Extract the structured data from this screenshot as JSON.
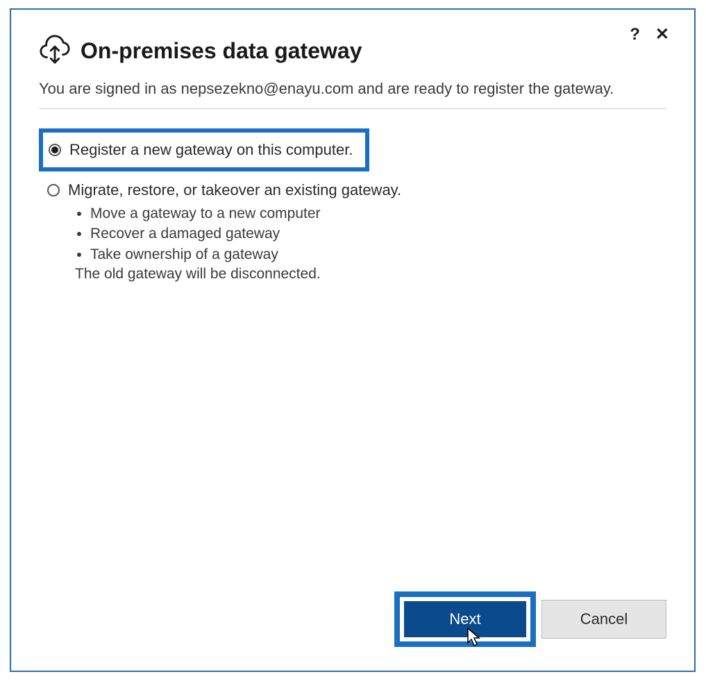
{
  "header": {
    "title": "On-premises data gateway",
    "subtitle": "You are signed in as nepsezekno@enayu.com and are ready to register the gateway."
  },
  "controls": {
    "help": "?",
    "close": "✕"
  },
  "options": {
    "register": {
      "label": "Register a new gateway on this computer.",
      "selected": true
    },
    "migrate": {
      "label": "Migrate, restore, or takeover an existing gateway.",
      "selected": false,
      "bullets": [
        "Move a gateway to a new computer",
        "Recover a damaged gateway",
        "Take ownership of a gateway"
      ],
      "note": "The old gateway will be disconnected."
    }
  },
  "buttons": {
    "next": "Next",
    "cancel": "Cancel"
  }
}
